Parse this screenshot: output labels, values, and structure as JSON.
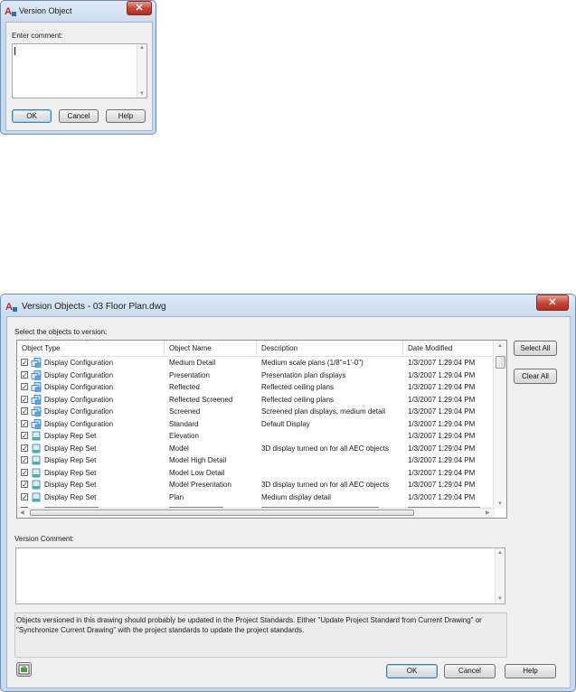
{
  "small_dialog": {
    "title": "Version Object",
    "close_label": "✕",
    "comment_label": "Enter comment:",
    "comment_value": "",
    "ok_label": "OK",
    "cancel_label": "Cancel",
    "help_label": "Help"
  },
  "main_dialog": {
    "title": "Version Objects - 03 Floor Plan.dwg",
    "close_label": "✕",
    "select_label": "Select the objects to version:",
    "columns": [
      "Object Type",
      "Object Name",
      "Description",
      "Date Modified"
    ],
    "rows": [
      {
        "type": "Display Configuration",
        "name": "Medium Detail",
        "description": "Medium scale plans (1/8\"=1'-0\")",
        "date": "1/3/2007 1:29:04 PM",
        "checked": true,
        "icon": "display-config-icon"
      },
      {
        "type": "Display Configuration",
        "name": "Presentation",
        "description": "Presentation plan displays",
        "date": "1/3/2007 1:29:04 PM",
        "checked": true,
        "icon": "display-config-icon"
      },
      {
        "type": "Display Configuration",
        "name": "Reflected",
        "description": "Reflected ceiling plans",
        "date": "1/3/2007 1:29:04 PM",
        "checked": true,
        "icon": "display-config-icon"
      },
      {
        "type": "Display Configuration",
        "name": "Reflected Screened",
        "description": "Reflected ceiling plans",
        "date": "1/3/2007 1:29:04 PM",
        "checked": true,
        "icon": "display-config-icon"
      },
      {
        "type": "Display Configuration",
        "name": "Screened",
        "description": "Screened plan displays, medium detail",
        "date": "1/3/2007 1:29:04 PM",
        "checked": true,
        "icon": "display-config-icon"
      },
      {
        "type": "Display Configuration",
        "name": "Standard",
        "description": "Default Display",
        "date": "1/3/2007 1:29:04 PM",
        "checked": true,
        "icon": "display-config-icon"
      },
      {
        "type": "Display Rep Set",
        "name": "Elevation",
        "description": "",
        "date": "1/3/2007 1:29:04 PM",
        "checked": true,
        "icon": "display-rep-set-icon"
      },
      {
        "type": "Display Rep Set",
        "name": "Model",
        "description": "3D display turned on for all AEC objects",
        "date": "1/3/2007 1:29:04 PM",
        "checked": true,
        "icon": "display-rep-set-icon"
      },
      {
        "type": "Display Rep Set",
        "name": "Model High Detail",
        "description": "",
        "date": "1/3/2007 1:29:04 PM",
        "checked": true,
        "icon": "display-rep-set-icon"
      },
      {
        "type": "Display Rep Set",
        "name": "Model Low Detail",
        "description": "",
        "date": "1/3/2007 1:29:04 PM",
        "checked": true,
        "icon": "display-rep-set-icon"
      },
      {
        "type": "Display Rep Set",
        "name": "Model Presentation",
        "description": "3D display turned on for all AEC objects",
        "date": "1/3/2007 1:29:04 PM",
        "checked": true,
        "icon": "display-rep-set-icon"
      },
      {
        "type": "Display Rep Set",
        "name": "Plan",
        "description": "Medium display detail",
        "date": "1/3/2007 1:29:04 PM",
        "checked": true,
        "icon": "display-rep-set-icon"
      }
    ],
    "select_all_label": "Select All",
    "clear_all_label": "Clear All",
    "comment_label": "Version Comment:",
    "comment_value": "",
    "info_text": "Objects versioned in this drawing should probably be updated in the Project Standards. Either \"Update Project Standard from Current Drawing\" or \"Synchronize Current Drawing\" with the project standards to update the project standards.",
    "ok_label": "OK",
    "cancel_label": "Cancel",
    "help_label": "Help"
  }
}
